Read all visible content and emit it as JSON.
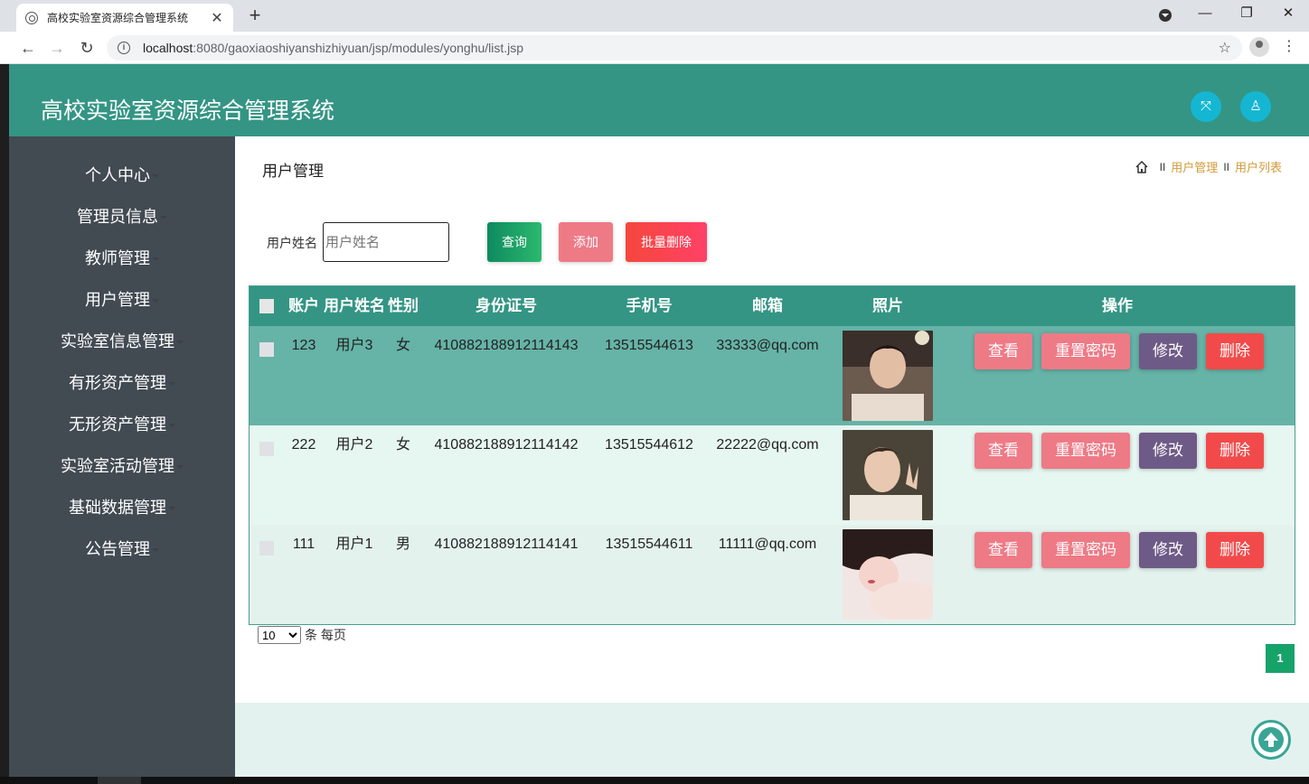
{
  "browser": {
    "tab_title": "高校实验室资源综合管理系统",
    "tab_close": "✕",
    "new_tab": "+",
    "url_host": "localhost",
    "url_rest": ":8080/gaoxiaoshiyanshizhiyuan/jsp/modules/yonghu/list.jsp",
    "back": "←",
    "forward": "→",
    "reload": "↻",
    "info": "i",
    "star": "☆",
    "menu": "⋮",
    "minimize": "—",
    "restore": "❐",
    "close": "✕"
  },
  "header": {
    "title": "高校实验室资源综合管理系统",
    "fullscreen_icon": "⤧",
    "user_icon": "♙"
  },
  "sidebar": {
    "items": [
      {
        "label": "个人中心"
      },
      {
        "label": "管理员信息"
      },
      {
        "label": "教师管理"
      },
      {
        "label": "用户管理"
      },
      {
        "label": "实验室信息管理"
      },
      {
        "label": "有形资产管理"
      },
      {
        "label": "无形资产管理"
      },
      {
        "label": "实验室活动管理"
      },
      {
        "label": "基础数据管理"
      },
      {
        "label": "公告管理"
      }
    ]
  },
  "page": {
    "title": "用户管理",
    "breadcrumb": {
      "sep": "II",
      "level1": "用户管理",
      "level2": "用户列表"
    }
  },
  "search": {
    "label": "用户姓名",
    "placeholder": "用户姓名",
    "query_btn": "查询",
    "add_btn": "添加",
    "batch_delete_btn": "批量删除"
  },
  "table": {
    "headers": [
      "账户",
      "用户姓名",
      "性别",
      "身份证号",
      "手机号",
      "邮箱",
      "照片",
      "操作"
    ],
    "rows": [
      {
        "account": "123",
        "name": "用户3",
        "gender": "女",
        "id_card": "410882188912114143",
        "phone": "13515544613",
        "email": "33333@qq.com"
      },
      {
        "account": "222",
        "name": "用户2",
        "gender": "女",
        "id_card": "410882188912114142",
        "phone": "13515544612",
        "email": "22222@qq.com"
      },
      {
        "account": "111",
        "name": "用户1",
        "gender": "男",
        "id_card": "410882188912114141",
        "phone": "13515544611",
        "email": "11111@qq.com"
      }
    ],
    "actions": {
      "view": "查看",
      "reset": "重置密码",
      "edit": "修改",
      "delete": "删除"
    }
  },
  "pagination": {
    "page_size": "10",
    "page_size_options": [
      "10"
    ],
    "per_page_text": "条 每页",
    "current_page": "1"
  },
  "colors": {
    "header": "#349584",
    "sidebar": "#424a52",
    "row_selected": "#66b3a7",
    "row_alt": "#e6f6f1",
    "btn_view": "#ee7a86",
    "btn_edit": "#6e5a86",
    "btn_delete": "#f24a4a"
  }
}
